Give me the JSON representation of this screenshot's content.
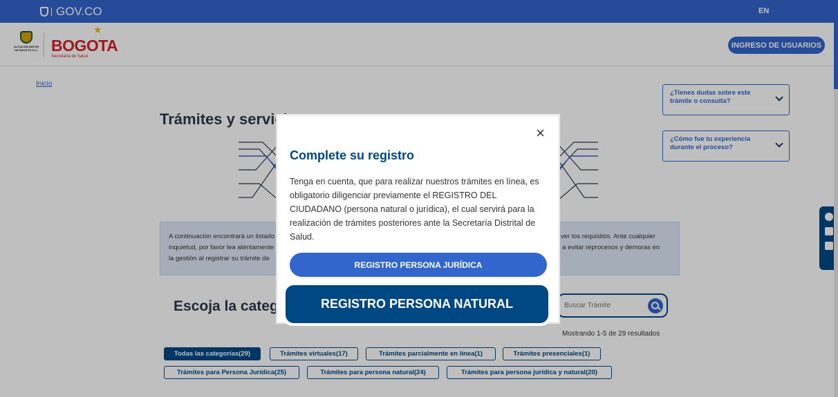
{
  "govbar": {
    "logo_text": "GOV.CO",
    "lang": "EN"
  },
  "header": {
    "escudo_text": "ALCALDÍA MAYOR DE BOGOTÁ D.C.",
    "brand": "BOGOTA",
    "brand_sub": "Secretaría de Salud",
    "login_label": "INGRESO DE USUARIOS"
  },
  "breadcrumb": "Inicio",
  "page_title": "Trámites y servicios",
  "faq": [
    {
      "label": "¿Tienes dudas sobre este trámite o consulta?"
    },
    {
      "label": "¿Cómo fue tu experiencia durante el proceso?"
    }
  ],
  "info": {
    "left_lines": [
      "A continuación encontrará un listado",
      "inquietud, por favor lea atentamente",
      "la gestión al registrar su trámite de"
    ],
    "right_lines": [
      "rá ver los requisitos. Ante cualquier",
      "de a evitar reprocesos y demoras en",
      ""
    ]
  },
  "categories": {
    "title": "Escoja la categoría",
    "search_placeholder": "Buscar Trámite",
    "results": "Mostrando 1-5 de 29 resultados",
    "chips": [
      {
        "label": "Todas las categorías(29)",
        "active": true
      },
      {
        "label": "Trámites virtuales(17)"
      },
      {
        "label": "Trámites parcialmente en línea(1)"
      },
      {
        "label": "Trámites presenciales(1)"
      },
      {
        "label": "Trámites para Persona Jurídica(25)"
      },
      {
        "label": "Trámites para persona natural(24)"
      },
      {
        "label": "Trámites para persona jurídica y natural(20)"
      }
    ]
  },
  "modal": {
    "close": "×",
    "title": "Complete su registro",
    "body": "Tenga en cuenta, que para realizar nuestros trámites en línea, es obligatorio diligenciar previamente el REGISTRO DEL CIUDADANO (persona natural o jurídica), el cual servirá para la realización de trámites posteriores ante la Secretaría Distrital de Salud.",
    "btn_juridica": "REGISTRO PERSONA JURÍDICA",
    "btn_natural": "REGISTRO PERSONA NATURAL"
  },
  "colors": {
    "gov_blue": "#3366cc",
    "navy": "#004884",
    "brand_red": "#d2232a"
  },
  "icons": [
    "shield-icon",
    "close-icon",
    "chevron-down-icon",
    "search-icon",
    "contrast-icon",
    "font-increase-icon",
    "font-decrease-icon"
  ]
}
